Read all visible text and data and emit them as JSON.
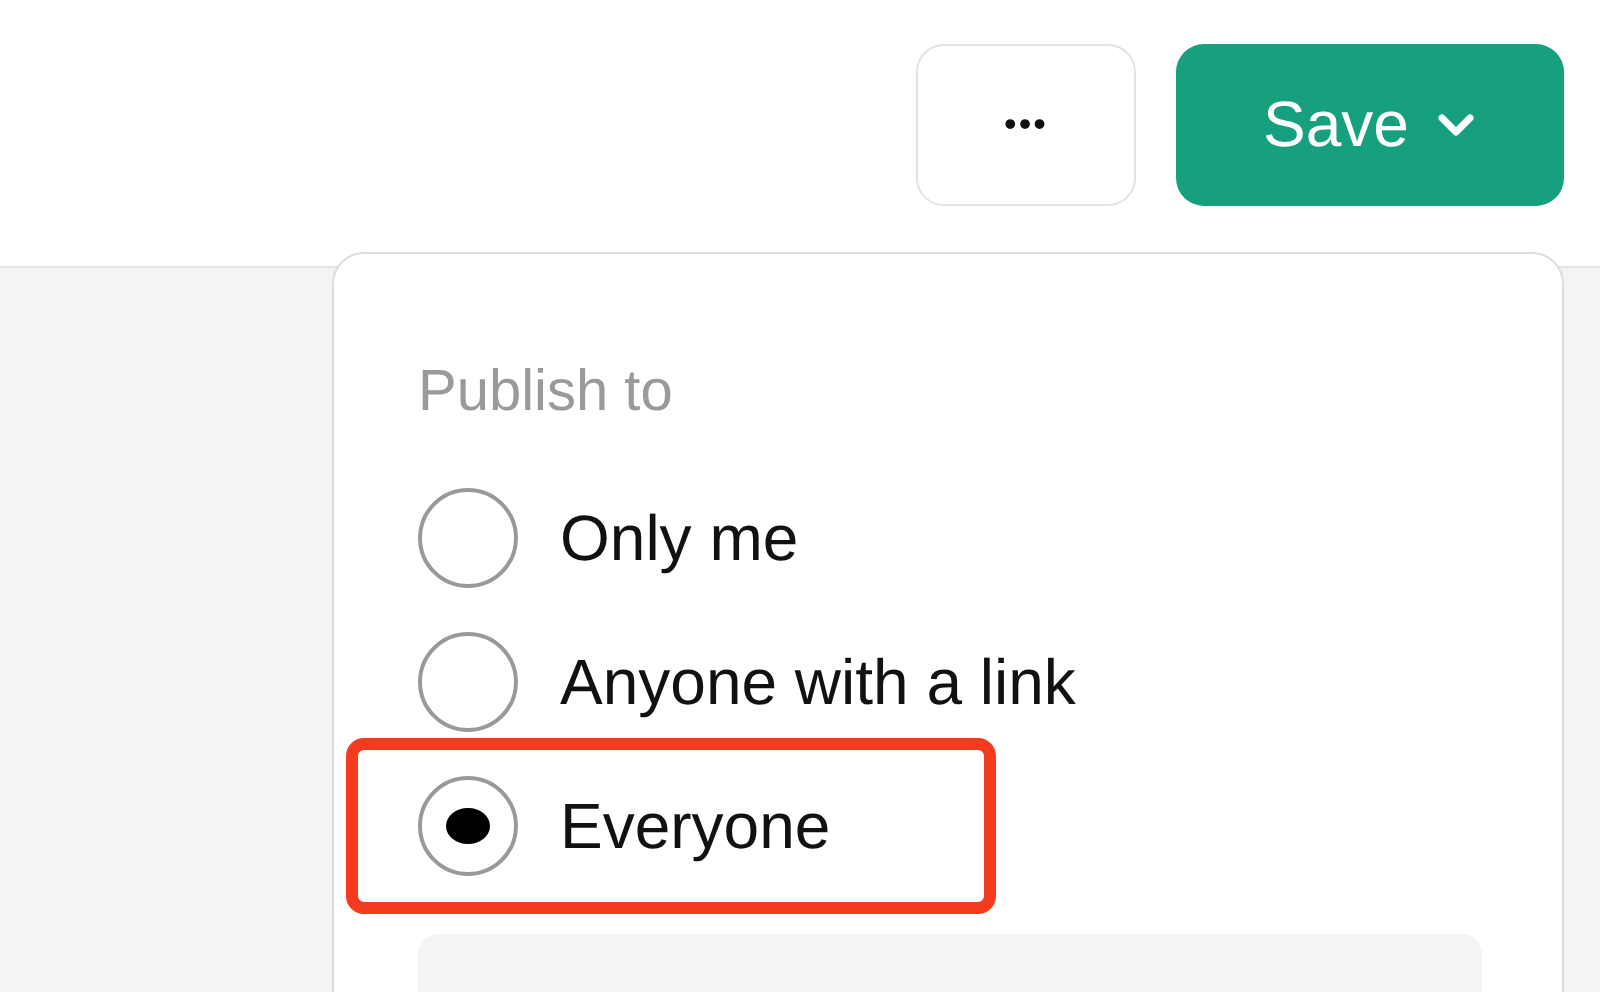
{
  "toolbar": {
    "more_button": "•••",
    "save_button": "Save"
  },
  "publish_menu": {
    "heading": "Publish to",
    "options": [
      {
        "label": "Only me",
        "selected": false,
        "highlighted": false
      },
      {
        "label": "Anyone with a link",
        "selected": false,
        "highlighted": false
      },
      {
        "label": "Everyone",
        "selected": true,
        "highlighted": true
      }
    ]
  }
}
